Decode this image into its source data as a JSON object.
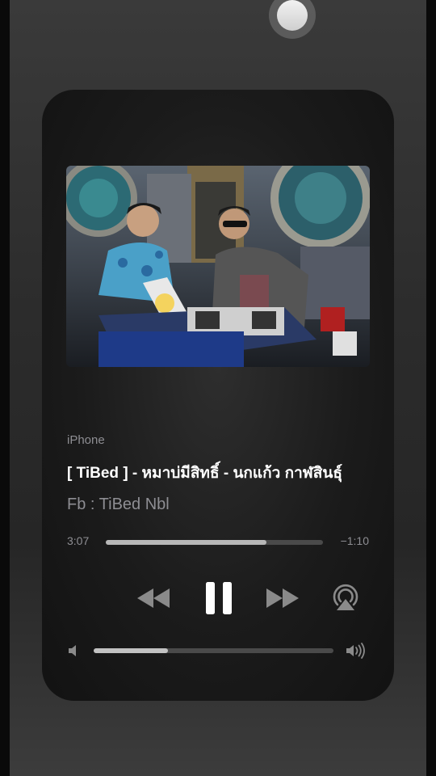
{
  "player": {
    "source": "iPhone",
    "title": "[ TiBed ] - หมาบ่มีสิทธิ์ - นกแก้ว กาฬสินธุ์",
    "artist": "Fb : TiBed Nbl",
    "elapsed": "3:07",
    "remaining": "−1:10",
    "progress_fraction": 0.74,
    "volume_fraction": 0.31,
    "is_playing": true
  },
  "icons": {
    "rewind": "rewind-icon",
    "pause": "pause-icon",
    "fast_forward": "fast-forward-icon",
    "airplay": "airplay-icon",
    "volume_low": "speaker-low-icon",
    "volume_high": "speaker-high-icon",
    "assistive_touch": "assistive-touch-icon"
  },
  "colors": {
    "accent": "#ffffff",
    "secondary_text": "#8e8e93",
    "track": "#4a4a4a",
    "fill": "#b8b8b8"
  }
}
